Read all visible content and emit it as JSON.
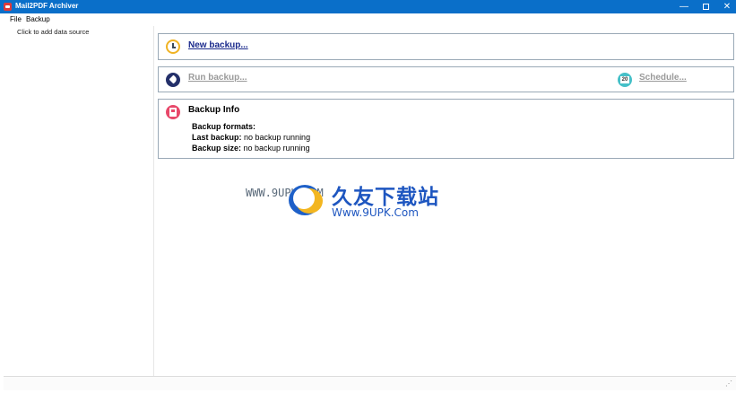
{
  "window": {
    "title": "Mail2PDF Archiver",
    "minimize_glyph": "—",
    "close_glyph": "✕"
  },
  "menu": {
    "file": "File",
    "backup": "Backup"
  },
  "left_panel": {
    "add_source": "Click to add data source"
  },
  "actions": {
    "new_backup": "New backup...",
    "run_backup": "Run backup...",
    "schedule": "Schedule..."
  },
  "info": {
    "title": "Backup Info",
    "formats_label": "Backup formats:",
    "formats_value": "",
    "last_label": "Last backup:",
    "last_value": " no backup running",
    "size_label": "Backup size:",
    "size_value": " no backup running"
  },
  "watermark": {
    "left_text": "WWW.9UPK.COM",
    "cn_text": "久友下载站",
    "url": "Www.9UPK.Com"
  },
  "icons": {
    "new_backup": "clock-icon",
    "run_backup": "rocket-icon",
    "schedule": "calendar-icon",
    "info": "info-clipboard-icon"
  },
  "colors": {
    "titlebar": "#0a6fc9",
    "link_active": "#1a2a8c",
    "link_disabled": "#9a9a9a",
    "card_border": "#9aa9b6"
  }
}
